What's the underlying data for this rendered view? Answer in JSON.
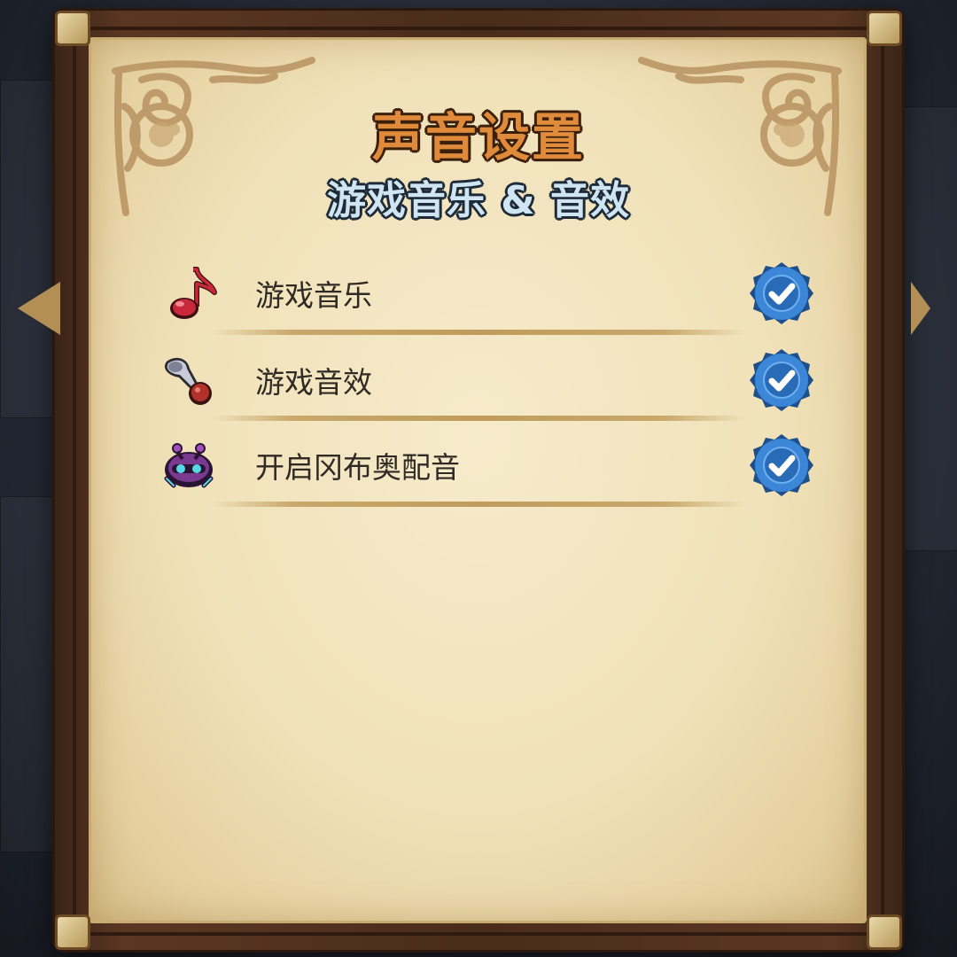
{
  "dialog": {
    "title": "声音设置",
    "subtitle": "游戏音乐 & 音效"
  },
  "settings": [
    {
      "label": "游戏音乐",
      "icon": "music-note-icon",
      "checked": true
    },
    {
      "label": "游戏音效",
      "icon": "horn-icon",
      "checked": true
    },
    {
      "label": "开启冈布奥配音",
      "icon": "gumball-creature-icon",
      "checked": true
    }
  ],
  "colors": {
    "title": "#e08a3c",
    "subtitle": "#cfe6f2",
    "checkbox": "#3b86d6",
    "parchment": "#f0e1b8",
    "frame": "#4a2c1b"
  }
}
